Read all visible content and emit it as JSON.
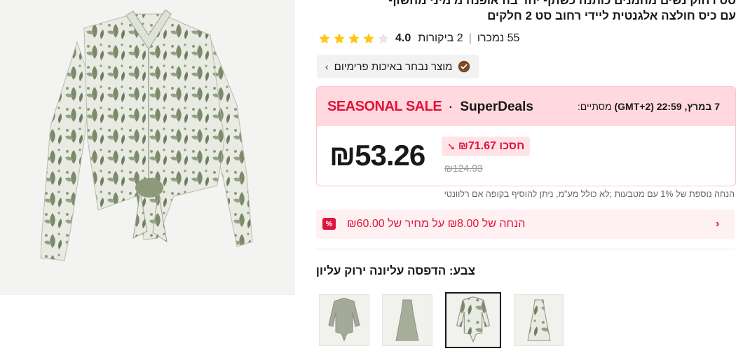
{
  "product": {
    "title_line1": "סט רחוק נשים מחמנים כותנה כשתף יחד בה אופנה מ מיני מחשוף",
    "title_line2": "עם כיס חולצה אלגנטית ליידי רחוב סט 2 חלקים",
    "rating": "4.0",
    "reviews": "2 ביקורות",
    "sold": "55 נמכרו",
    "premium_label": "מוצר נבחר באיכות פרימיום"
  },
  "deal": {
    "seasonal": "SEASONAL SALE",
    "dot": "·",
    "superdeals": "SuperDeals",
    "end_prefix": "מסתיים:",
    "end_time": "7 במרץ, 22:59 (GMT+2)",
    "price": "₪53.26",
    "save": "חסכו ₪71.67",
    "old_price": "₪124.93"
  },
  "extra_note": "הנחה נוספת של 1% עם מטבעות ;לא כולל מע\"מ, ניתן להוסיף בקופה אם רלוונטי",
  "coupon": {
    "text": "הנחה של ₪8.00 על מחיר של ₪60.00",
    "icon_label": "%"
  },
  "color_label": "צבע: הדפסה עליונה ירוק עליון",
  "colors": {
    "accent": "#e0133a",
    "deal_header_bg": "#ffd9de",
    "star": "#ffc50f"
  },
  "icons": [
    "chevron-left-icon",
    "premium-badge-icon",
    "price-drop-arrow-icon",
    "coupon-percent-icon",
    "star-icon"
  ]
}
